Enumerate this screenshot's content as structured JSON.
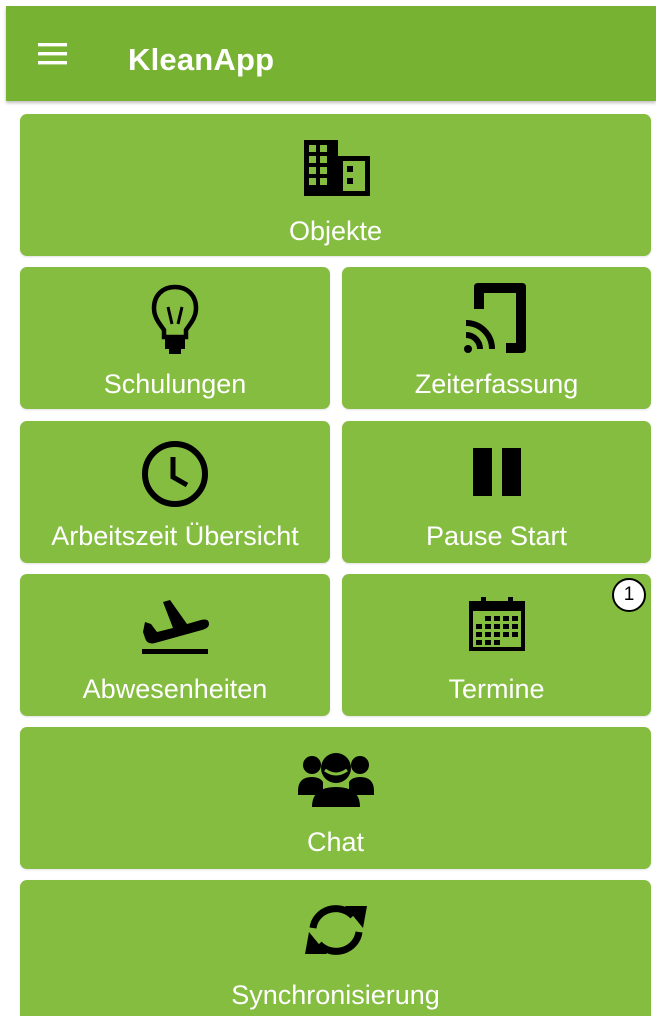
{
  "app": {
    "title": "KleanApp"
  },
  "tiles": {
    "objekte": {
      "label": "Objekte",
      "icon": "building-icon"
    },
    "schulungen": {
      "label": "Schulungen",
      "icon": "lightbulb-icon"
    },
    "zeiterfassung": {
      "label": "Zeiterfassung",
      "icon": "cast-tablet-icon"
    },
    "arbeitszeit": {
      "label": "Arbeitszeit Übersicht",
      "icon": "clock-icon"
    },
    "pause": {
      "label": "Pause Start",
      "icon": "pause-icon"
    },
    "abwesenheiten": {
      "label": "Abwesenheiten",
      "icon": "airplane-departure-icon"
    },
    "termine": {
      "label": "Termine",
      "icon": "calendar-icon",
      "badge": "1"
    },
    "chat": {
      "label": "Chat",
      "icon": "group-chat-icon"
    },
    "sync": {
      "label": "Synchronisierung",
      "icon": "sync-icon"
    }
  },
  "colors": {
    "appbar": "#78b232",
    "tile": "#85bd40",
    "text": "#ffffff",
    "icon": "#000000"
  }
}
